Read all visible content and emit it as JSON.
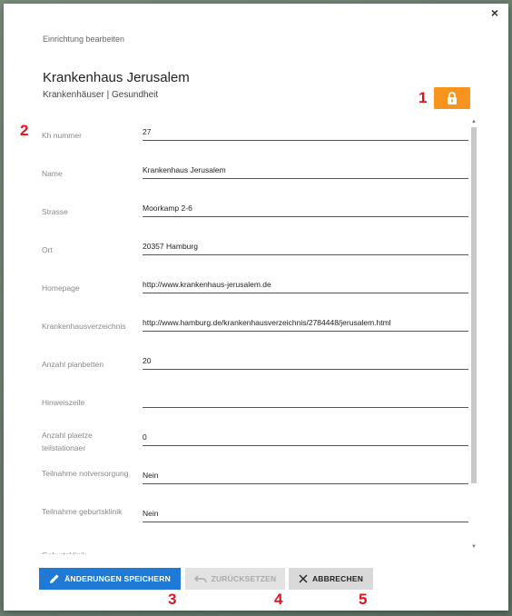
{
  "header": {
    "caption": "Einrichtung bearbeiten",
    "title": "Krankenhaus Jerusalem",
    "subtitle": "Krankenhäuser | Gesundheit"
  },
  "annotations": {
    "a1": "1",
    "a2": "2",
    "a3": "3",
    "a4": "4",
    "a5": "5"
  },
  "close_icon": "×",
  "lock_icon": "lock-icon",
  "fields": [
    {
      "label": "Kh nummer",
      "value": "27"
    },
    {
      "label": "Name",
      "value": "Krankenhaus Jerusalem"
    },
    {
      "label": "Strasse",
      "value": "Moorkamp 2-6"
    },
    {
      "label": "Ort",
      "value": "20357  Hamburg"
    },
    {
      "label": "Homepage",
      "value": "http://www.krankenhaus-jerusalem.de"
    },
    {
      "label": "Krankenhausverzeichnis",
      "value": "http://www.hamburg.de/krankenhausverzeichnis/2784448/jerusalem.html"
    },
    {
      "label": "Anzahl planbetten",
      "value": "20"
    },
    {
      "label": "Hinweiszeile",
      "value": ""
    },
    {
      "label": "Anzahl plaetze teilstationaer",
      "value": "0"
    },
    {
      "label": "Teilnahme notversorgung",
      "value": "Nein"
    },
    {
      "label": "Teilnahme geburtsklinik",
      "value": "Nein"
    },
    {
      "label": "Geburtsklinik",
      "value": ""
    }
  ],
  "buttons": {
    "save": "ÄNDERUNGEN SPEICHERN",
    "reset": "ZURÜCKSETZEN",
    "cancel": "ABBRECHEN"
  },
  "colors": {
    "accent": "#1e7ad6",
    "lock": "#f7941d",
    "annotation": "#e8101a"
  }
}
